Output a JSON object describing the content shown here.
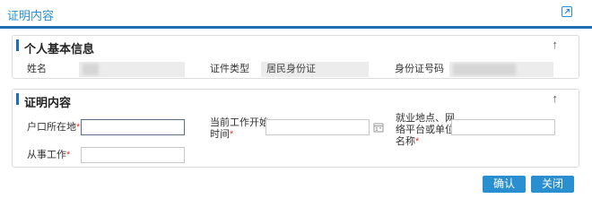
{
  "window": {
    "title": "证明内容",
    "popout_icon": "popout-icon"
  },
  "basic_info": {
    "title": "个人基本信息",
    "collapse_icon": "arrow-up-icon",
    "name_label": "姓名",
    "name_value": "",
    "id_type_label": "证件类型",
    "id_type_value": "居民身份证",
    "id_number_label": "身份证号码",
    "id_number_value": ""
  },
  "proof": {
    "title": "证明内容",
    "collapse_icon": "arrow-up-icon",
    "hukou_label": "户口所在地",
    "hukou_value": "",
    "work_start_label_line1": "当前工作开始",
    "work_start_label_line2": "时间",
    "work_start_value": "",
    "calendar_icon": "calendar-icon",
    "employer_label_line1": "就业地点、网",
    "employer_label_line2": "络平台或单位",
    "employer_label_line3": "名称",
    "employer_value": "",
    "occupation_label": "从事工作",
    "occupation_value": "",
    "required_mark": "*"
  },
  "actions": {
    "confirm_label": "确认",
    "close_label": "关闭"
  },
  "colors": {
    "accent": "#2a8fd0",
    "rule": "#1f6fb5",
    "required": "#e03c31"
  }
}
